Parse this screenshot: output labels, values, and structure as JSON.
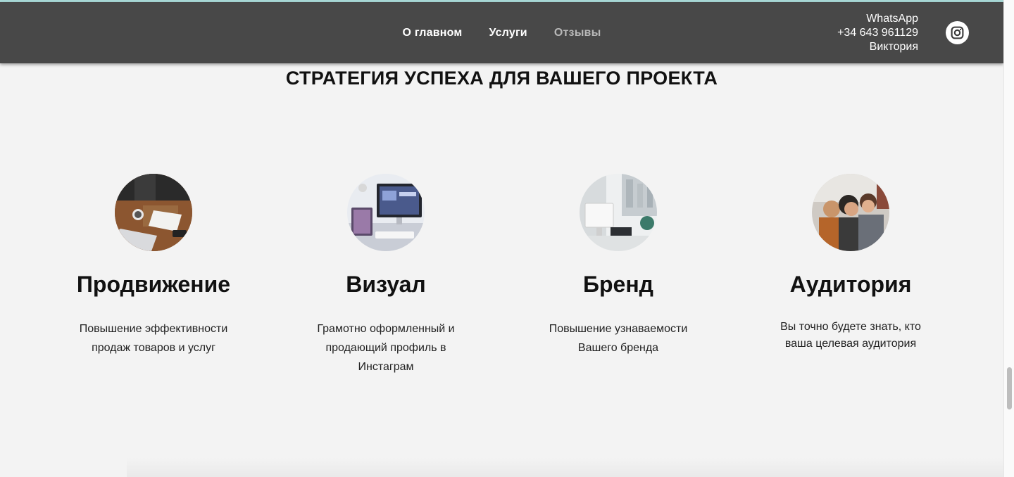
{
  "nav": {
    "items": [
      {
        "label": "О главном"
      },
      {
        "label": "Услуги"
      },
      {
        "label": "Отзывы"
      }
    ]
  },
  "contact": {
    "line1": "WhatsApp",
    "line2": "+34 643 961129",
    "line3": "Виктория"
  },
  "icons": {
    "social": "instagram-icon"
  },
  "colors": {
    "header_bg": "#484848",
    "page_bg": "#f3f3f3",
    "nav_muted": "#b8b8b8",
    "top_strip": "#a8d8d6"
  },
  "section": {
    "title": "СТРАТЕГИЯ УСПЕХА ДЛЯ ВАШЕГО ПРОЕКТА"
  },
  "cards": [
    {
      "title": "Продвижение",
      "text": "Повышение эффективности продаж товаров и услуг"
    },
    {
      "title": "Визуал",
      "text": "Грамотно оформленный и продающий профиль в Инстаграм"
    },
    {
      "title": "Бренд",
      "text": "Повышение узнаваемости Вашего бренда"
    },
    {
      "title": "Аудитория",
      "text": "Вы точно будете знать, кто ваша целевая аудитория"
    }
  ]
}
